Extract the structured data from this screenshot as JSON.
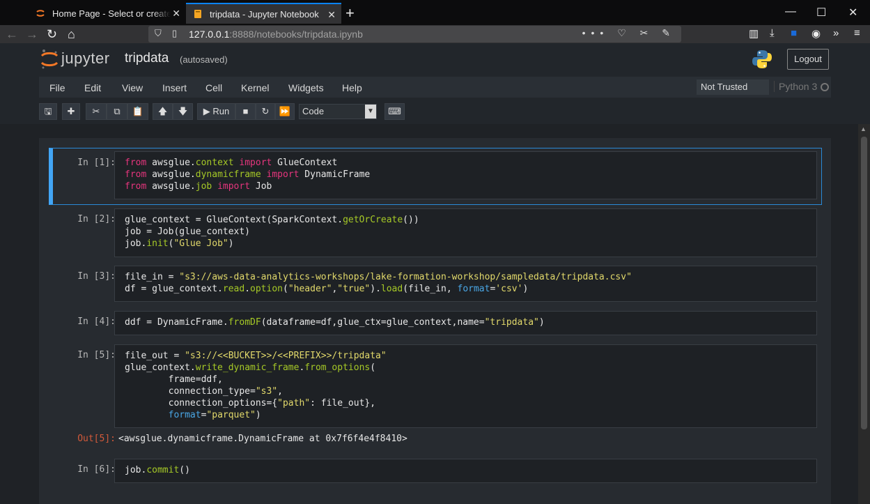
{
  "browser": {
    "tabs": [
      {
        "title": "Home Page - Select or create a notebook",
        "active": false
      },
      {
        "title": "tripdata - Jupyter Notebook",
        "active": true
      }
    ],
    "url_host": "127.0.0.1",
    "url_path": ":8888/notebooks/tripdata.ipynb",
    "url_icons": "••• ♡ ✂ ✎"
  },
  "jupyter": {
    "brand": "jupyter",
    "notebook_title": "tripdata",
    "autosave": "(autosaved)",
    "logout_label": "Logout",
    "menu": [
      "File",
      "Edit",
      "View",
      "Insert",
      "Cell",
      "Kernel",
      "Widgets",
      "Help"
    ],
    "trust_status": "Not Trusted",
    "kernel_name": "Python 3",
    "toolbar": {
      "run_label": "Run",
      "cell_type": "Code"
    }
  },
  "cells": [
    {
      "prompt": "In [1]:"
    },
    {
      "prompt": "In [2]:"
    },
    {
      "prompt": "In [3]:"
    },
    {
      "prompt": "In [4]:"
    },
    {
      "prompt": "In [5]:",
      "output_prompt": "Out[5]:",
      "output": "<awsglue.dynamicframe.DynamicFrame at 0x7f6f4e4f8410>"
    },
    {
      "prompt": "In [6]:"
    }
  ],
  "code": {
    "c1": [
      [
        [
          "kw",
          "from"
        ],
        [
          "t",
          " awsglue."
        ],
        [
          "fn",
          "context"
        ],
        [
          "t",
          " "
        ],
        [
          "kw",
          "import"
        ],
        [
          "t",
          " GlueContext"
        ]
      ],
      [
        [
          "kw",
          "from"
        ],
        [
          "t",
          " awsglue."
        ],
        [
          "fn",
          "dynamicframe"
        ],
        [
          "t",
          " "
        ],
        [
          "kw",
          "import"
        ],
        [
          "t",
          " DynamicFrame"
        ]
      ],
      [
        [
          "kw",
          "from"
        ],
        [
          "t",
          " awsglue."
        ],
        [
          "fn",
          "job"
        ],
        [
          "t",
          " "
        ],
        [
          "kw",
          "import"
        ],
        [
          "t",
          " Job"
        ]
      ]
    ],
    "c2": [
      [
        [
          "t",
          "glue_context = GlueContext(SparkContext."
        ],
        [
          "fn",
          "getOrCreate"
        ],
        [
          "t",
          "())"
        ]
      ],
      [
        [
          "t",
          "job = Job(glue_context)"
        ]
      ],
      [
        [
          "t",
          "job."
        ],
        [
          "fn",
          "init"
        ],
        [
          "t",
          "("
        ],
        [
          "st",
          "\"Glue Job\""
        ],
        [
          "t",
          ")"
        ]
      ]
    ],
    "c3": [
      [
        [
          "t",
          "file_in = "
        ],
        [
          "st",
          "\"s3://aws-data-analytics-workshops/lake-formation-workshop/sampledata/tripdata.csv\""
        ]
      ],
      [
        [
          "t",
          "df = glue_context."
        ],
        [
          "fn",
          "read"
        ],
        [
          "t",
          "."
        ],
        [
          "fn",
          "option"
        ],
        [
          "t",
          "("
        ],
        [
          "st",
          "\"header\""
        ],
        [
          "t",
          ","
        ],
        [
          "st",
          "\"true\""
        ],
        [
          "t",
          ")."
        ],
        [
          "fn",
          "load"
        ],
        [
          "t",
          "(file_in, "
        ],
        [
          "kwarg",
          "format"
        ],
        [
          "t",
          "="
        ],
        [
          "st",
          "'csv'"
        ],
        [
          "t",
          ")"
        ]
      ]
    ],
    "c4": [
      [
        [
          "t",
          "ddf = DynamicFrame."
        ],
        [
          "fn",
          "fromDF"
        ],
        [
          "t",
          "(dataframe=df,glue_ctx=glue_context,name="
        ],
        [
          "st",
          "\"tripdata\""
        ],
        [
          "t",
          ")"
        ]
      ]
    ],
    "c5": [
      [
        [
          "t",
          "file_out = "
        ],
        [
          "st",
          "\"s3://<<BUCKET>>/<<PREFIX>>/tripdata\""
        ]
      ],
      [
        [
          "t",
          "glue_context."
        ],
        [
          "fn",
          "write_dynamic_frame"
        ],
        [
          "t",
          "."
        ],
        [
          "fn",
          "from_options"
        ],
        [
          "t",
          "("
        ]
      ],
      [
        [
          "t",
          "        frame=ddf,"
        ]
      ],
      [
        [
          "t",
          "        connection_type="
        ],
        [
          "st",
          "\"s3\""
        ],
        [
          "t",
          ","
        ]
      ],
      [
        [
          "t",
          "        connection_options={"
        ],
        [
          "st",
          "\"path\""
        ],
        [
          "t",
          ": file_out},"
        ]
      ],
      [
        [
          "t",
          "        "
        ],
        [
          "kwarg",
          "format"
        ],
        [
          "t",
          "="
        ],
        [
          "st",
          "\"parquet\""
        ],
        [
          "t",
          ")"
        ]
      ]
    ],
    "c6": [
      [
        [
          "t",
          "job."
        ],
        [
          "fn",
          "commit"
        ],
        [
          "t",
          "()"
        ]
      ]
    ]
  }
}
